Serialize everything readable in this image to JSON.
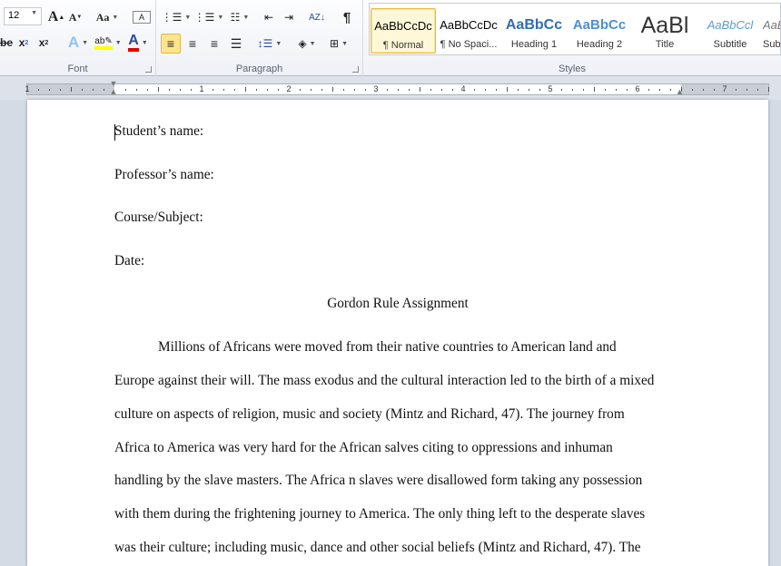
{
  "ribbon": {
    "font_group": {
      "label": "Font",
      "font_size": "12",
      "buttons": [
        "Grow Font",
        "Shrink Font",
        "Change Case",
        "Clear Formatting",
        "Strikethrough",
        "Subscript",
        "Superscript",
        "Text Effects",
        "Text Highlight Color",
        "Font Color"
      ],
      "highlight_color": "#ffff00",
      "font_color": "#e00000"
    },
    "paragraph_group": {
      "label": "Paragraph",
      "pilcrow": "¶"
    },
    "styles_group": {
      "label": "Styles",
      "styles": [
        {
          "preview": "AaBbCcDc",
          "name": "¶ Normal",
          "selected": true
        },
        {
          "preview": "AaBbCcDc",
          "name": "¶ No Spaci..."
        },
        {
          "preview": "AaBbCc",
          "name": "Heading 1"
        },
        {
          "preview": "AaBbCc",
          "name": "Heading 2"
        },
        {
          "preview": "AaBl",
          "name": "Title"
        },
        {
          "preview": "AaBbCcl",
          "name": "Subtitle"
        },
        {
          "preview": "AaBbCcl",
          "name": "Subtle Emphasis"
        }
      ]
    }
  },
  "ruler": {
    "numbers": [
      "1",
      "1",
      "2",
      "3",
      "4",
      "5",
      "6",
      "7"
    ]
  },
  "document": {
    "lines": [
      "Student’s name:",
      "Professor’s name:",
      "Course/Subject:",
      "Date:"
    ],
    "title": "Gordon Rule Assignment",
    "body": [
      "Millions of Africans were moved from their native countries to American land and",
      "Europe against their will. The mass exodus and the cultural interaction led to the birth of a mixed",
      "culture on aspects of religion, music and society (Mintz and Richard, 47). The journey from",
      "Africa to America was very hard for the African salves citing to oppressions and inhuman",
      "handling by the slave masters. The Africa n slaves were disallowed form taking any possession",
      "with them during the frightening journey to America. The only thing left to the desperate slaves",
      "was their culture; including music, dance and other social beliefs (Mintz and Richard, 47). The"
    ]
  }
}
